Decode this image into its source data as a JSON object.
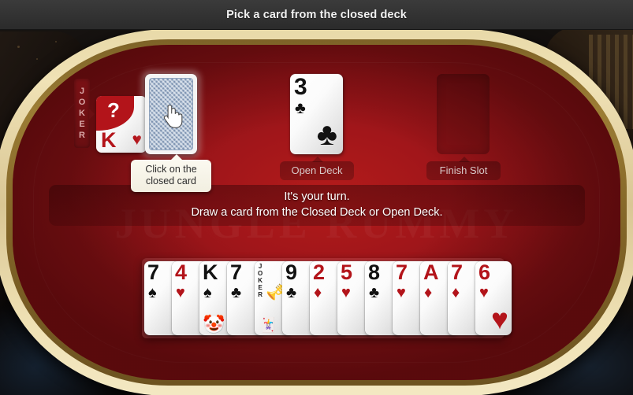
{
  "topbar": {
    "message": "Pick a card from the closed deck"
  },
  "watermark": {
    "text": "JUNGLE RUMMY"
  },
  "joker_indicator": {
    "label_letters": [
      "J",
      "O",
      "K",
      "E",
      "R"
    ],
    "wildcard": {
      "question_mark": "?",
      "rank": "K",
      "suit": "♥",
      "color": "#b3141a"
    }
  },
  "closed_deck": {
    "name": "Closed Deck",
    "cursor_icon": "hand-pointer-icon",
    "tooltip_line1": "Click on the",
    "tooltip_line2": "closed card"
  },
  "open_deck": {
    "label": "Open Deck",
    "top_card": {
      "rank": "3",
      "suit": "♣",
      "color": "black"
    }
  },
  "finish_slot": {
    "label": "Finish Slot",
    "empty": true
  },
  "turn_banner": {
    "line1": "It's your turn.",
    "line2": "Draw a card from the Closed Deck or Open Deck."
  },
  "hand": {
    "cards": [
      {
        "rank": "7",
        "suit": "♠",
        "color": "black",
        "joker": false
      },
      {
        "rank": "4",
        "suit": "♥",
        "color": "red",
        "joker": false
      },
      {
        "rank": "K",
        "suit": "♠",
        "color": "black",
        "joker": false
      },
      {
        "rank": "7",
        "suit": "♣",
        "color": "black",
        "joker": false
      },
      {
        "rank": "JOKER",
        "suit": "",
        "color": "black",
        "joker": true
      },
      {
        "rank": "9",
        "suit": "♣",
        "color": "black",
        "joker": false
      },
      {
        "rank": "2",
        "suit": "♦",
        "color": "red",
        "joker": false
      },
      {
        "rank": "5",
        "suit": "♥",
        "color": "red",
        "joker": false
      },
      {
        "rank": "8",
        "suit": "♣",
        "color": "black",
        "joker": false
      },
      {
        "rank": "7",
        "suit": "♥",
        "color": "red",
        "joker": false
      },
      {
        "rank": "A",
        "suit": "♦",
        "color": "red",
        "joker": false
      },
      {
        "rank": "7",
        "suit": "♦",
        "color": "red",
        "joker": false
      },
      {
        "rank": "6",
        "suit": "♥",
        "color": "red",
        "joker": false
      }
    ]
  },
  "colors": {
    "felt": "#a5171b",
    "rail_gold": "#8a6b2b",
    "rail_cream": "#ecdfb0",
    "topbar": "#333333",
    "card_red": "#b3141a",
    "card_black": "#121212"
  }
}
